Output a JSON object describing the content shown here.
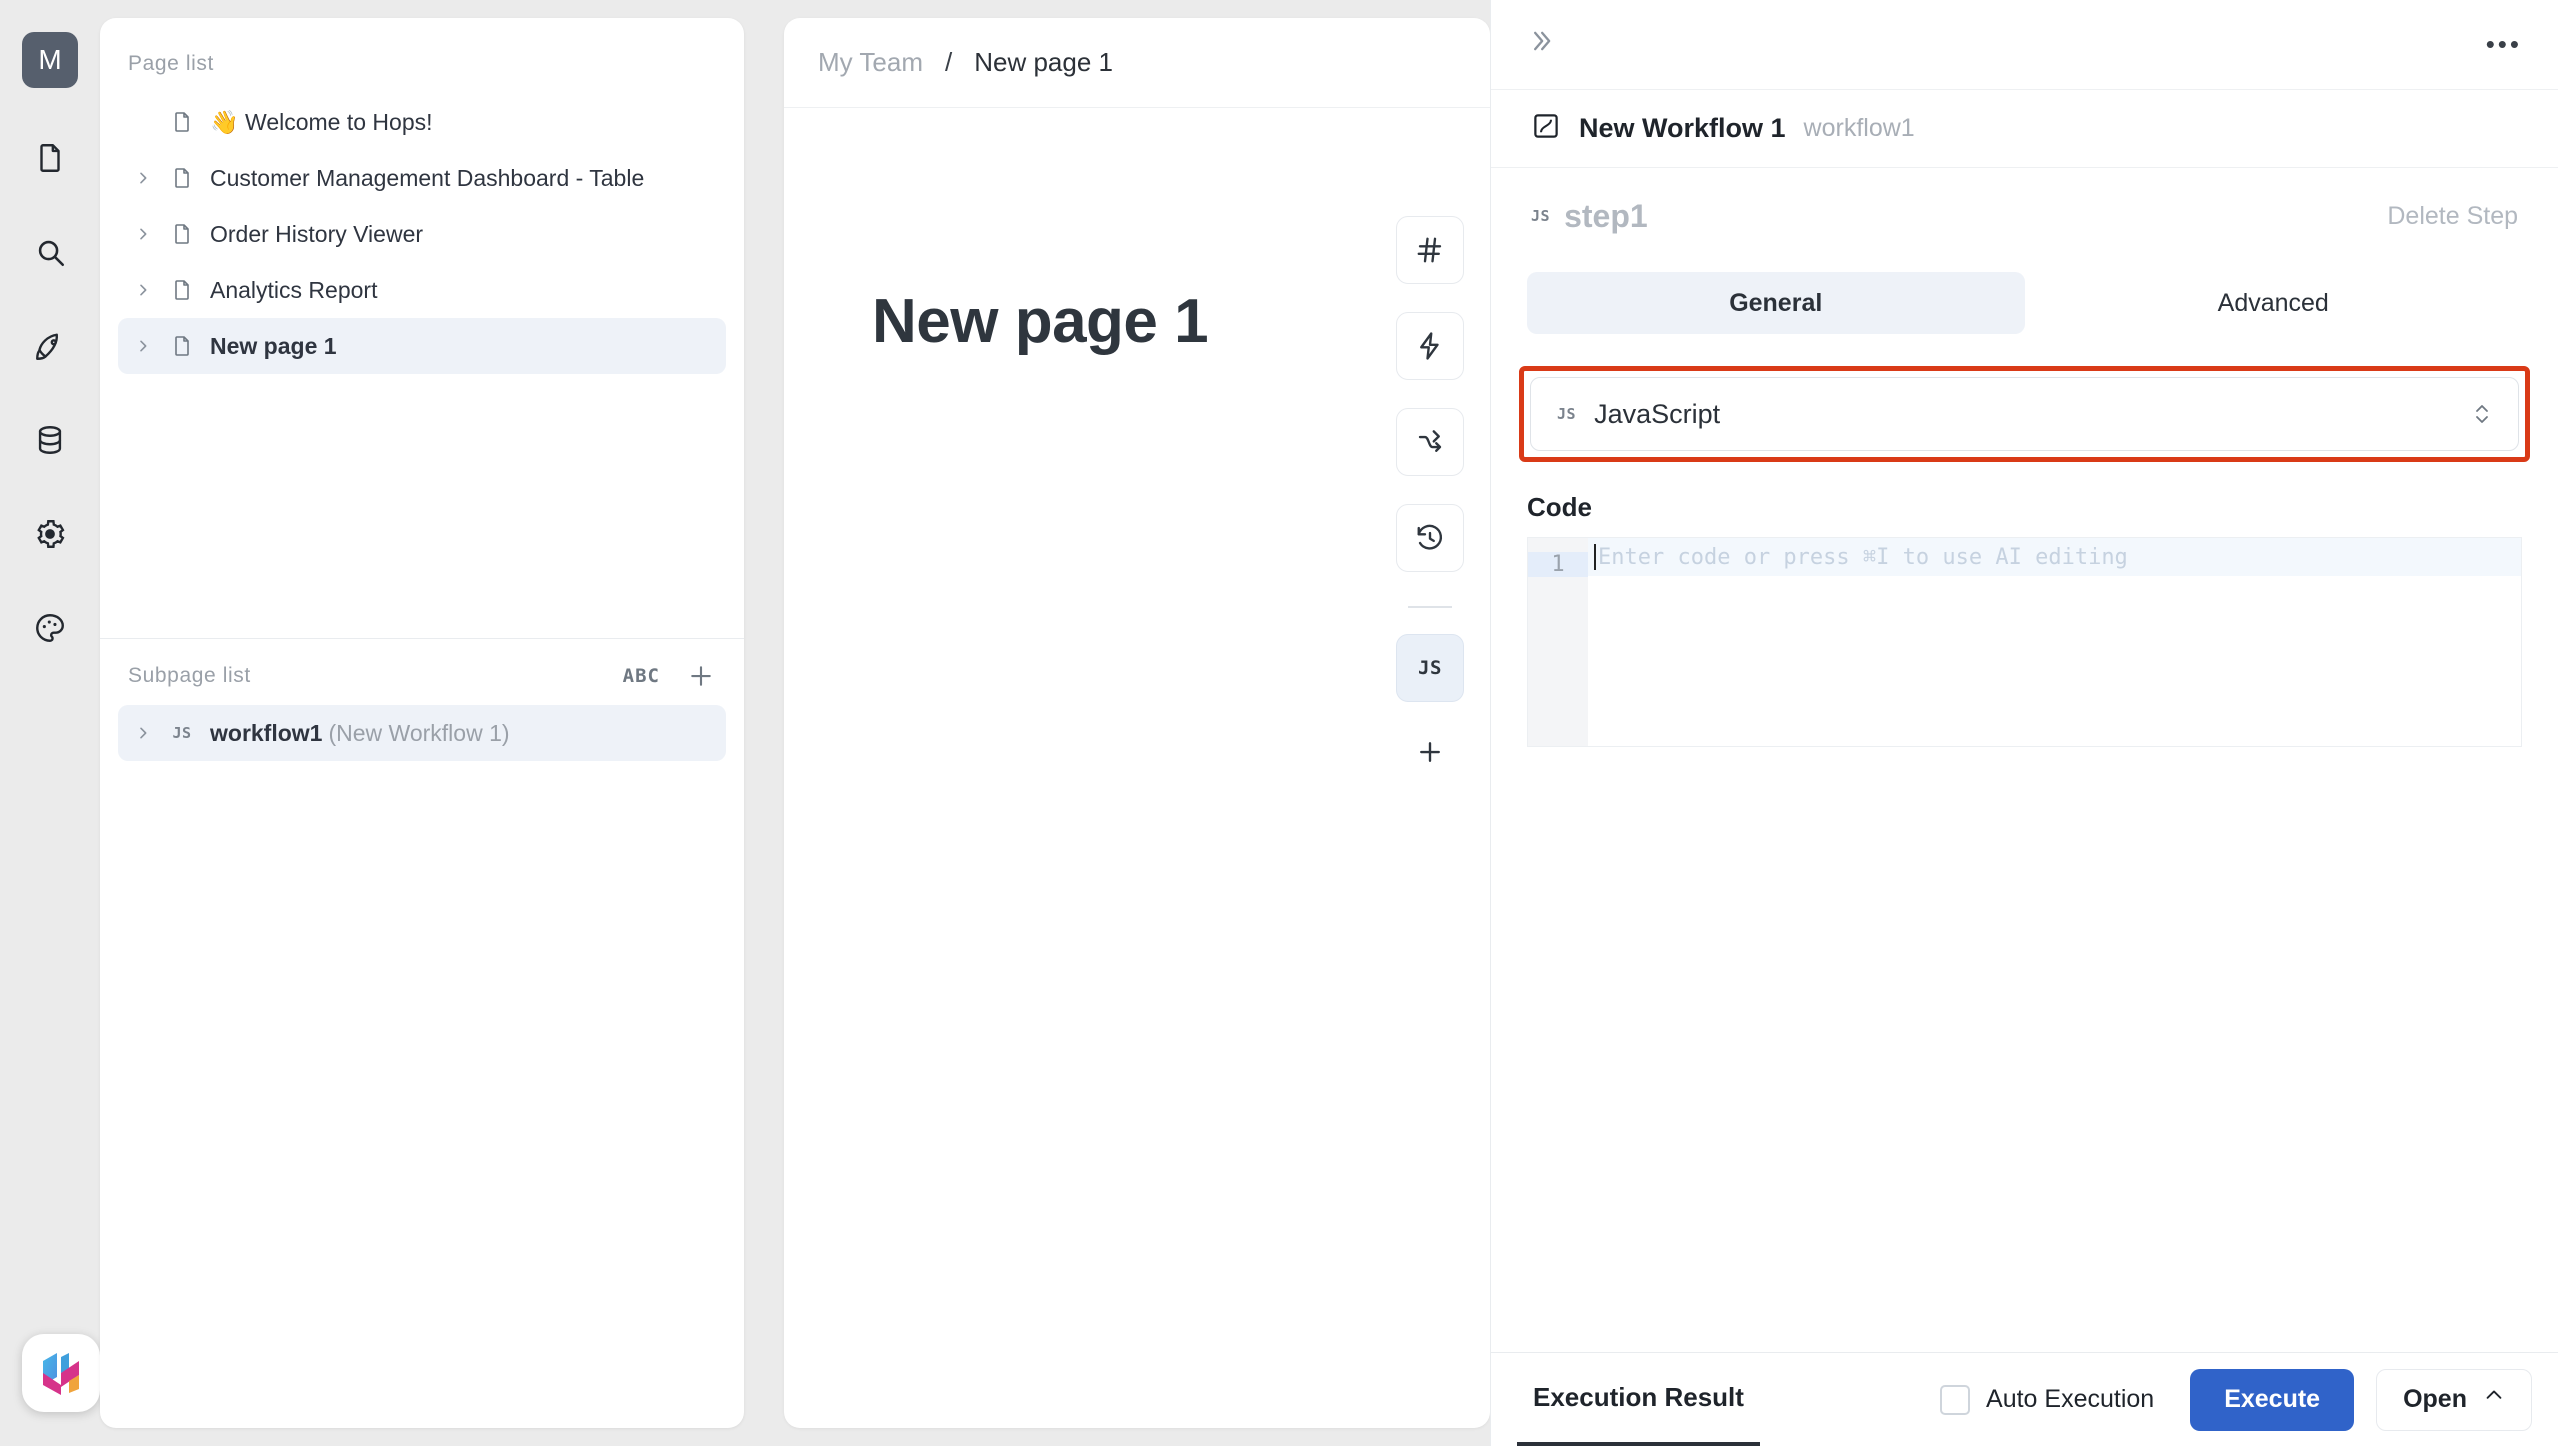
{
  "rail": {
    "avatar_label": "M",
    "items": [
      {
        "name": "document-icon"
      },
      {
        "name": "search-icon"
      },
      {
        "name": "rocket-icon"
      },
      {
        "name": "database-icon"
      },
      {
        "name": "gear-icon"
      },
      {
        "name": "palette-icon"
      }
    ]
  },
  "sidebar": {
    "page_list_title": "Page list",
    "pages": [
      {
        "label": "👋 Welcome to Hops!",
        "caret": false,
        "active": false
      },
      {
        "label": "Customer Management Dashboard - Table",
        "caret": true,
        "active": false
      },
      {
        "label": "Order History Viewer",
        "caret": true,
        "active": false
      },
      {
        "label": "Analytics Report",
        "caret": true,
        "active": false
      },
      {
        "label": "New page 1",
        "caret": true,
        "active": true
      }
    ],
    "subpage_list_title": "Subpage list",
    "abc_label": "ABC",
    "subpages": [
      {
        "name": "workflow1",
        "alias": "(New Workflow 1)",
        "badge": "JS"
      }
    ]
  },
  "center": {
    "breadcrumb": {
      "team": "My Team",
      "separator": "/",
      "current": "New page 1"
    },
    "page_title": "New page 1",
    "toolbar": [
      {
        "name": "hash-icon",
        "label": "#",
        "selected": false
      },
      {
        "name": "lightning-icon",
        "label": "",
        "selected": false
      },
      {
        "name": "branch-icon",
        "label": "",
        "selected": false
      },
      {
        "name": "history-icon",
        "label": "",
        "selected": false
      },
      {
        "name": "js-icon",
        "label": "JS",
        "selected": true
      }
    ],
    "add_label": "+"
  },
  "right": {
    "workflow": {
      "name": "New Workflow 1",
      "key": "workflow1"
    },
    "step": {
      "badge": "JS",
      "name": "step1",
      "delete_label": "Delete Step"
    },
    "tabs": [
      {
        "label": "General",
        "active": true
      },
      {
        "label": "Advanced",
        "active": false
      }
    ],
    "language": {
      "badge": "JS",
      "value": "JavaScript",
      "highlight_color": "#d93a17"
    },
    "code": {
      "label": "Code",
      "line_number": "1",
      "placeholder": "Enter code or press ⌘I to use AI editing"
    },
    "footer": {
      "result_tab": "Execution Result",
      "auto_execution_label": "Auto Execution",
      "auto_execution_checked": false,
      "execute_label": "Execute",
      "execute_color": "#3063c9",
      "open_label": "Open"
    }
  }
}
